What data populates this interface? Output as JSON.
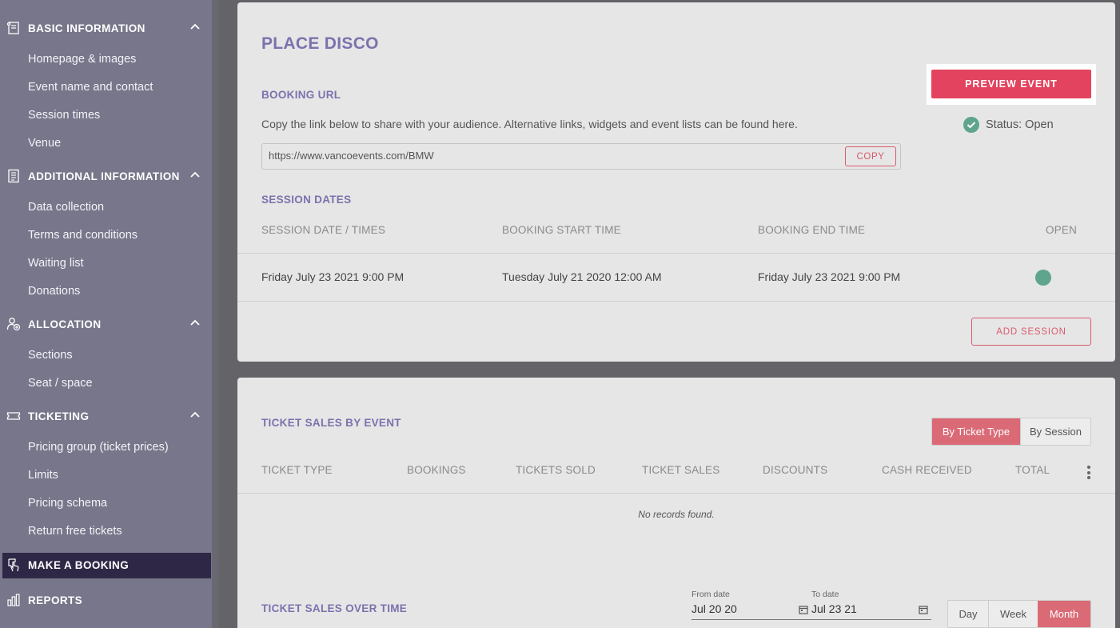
{
  "sidebar": {
    "groups": [
      {
        "label": "BASIC INFORMATION",
        "icon": "form-icon",
        "items": [
          "Homepage & images",
          "Event name and contact",
          "Session times",
          "Venue"
        ]
      },
      {
        "label": "ADDITIONAL INFORMATION",
        "icon": "document-icon",
        "items": [
          "Data collection",
          "Terms and conditions",
          "Waiting list",
          "Donations"
        ]
      },
      {
        "label": "ALLOCATION",
        "icon": "user-add-icon",
        "items": [
          "Sections",
          "Seat / space"
        ]
      },
      {
        "label": "TICKETING",
        "icon": "ticket-icon",
        "items": [
          "Pricing group (ticket prices)",
          "Limits",
          "Pricing schema",
          "Return free tickets"
        ]
      }
    ],
    "make_booking": {
      "label": "MAKE A BOOKING",
      "icon": "hand-pointer-icon"
    },
    "reports": {
      "label": "REPORTS",
      "icon": "bar-chart-icon"
    }
  },
  "event": {
    "title": "PLACE DISCO",
    "booking_url_label": "BOOKING URL",
    "description": "Copy the link below to share with your audience. Alternative links, widgets and event lists can be found here.",
    "url": "https://www.vancoevents.com/BMW",
    "copy_label": "COPY",
    "preview_label": "PREVIEW EVENT",
    "status": "Status: Open"
  },
  "sessions": {
    "label": "SESSION DATES",
    "columns": [
      "SESSION DATE / TIMES",
      "BOOKING START TIME",
      "BOOKING END TIME",
      "OPEN"
    ],
    "rows": [
      {
        "date": "Friday July 23 2021 9:00 PM",
        "start": "Tuesday July 21 2020 12:00 AM",
        "end": "Friday July 23 2021 9:00 PM",
        "open": true
      }
    ],
    "add_label": "ADD SESSION"
  },
  "ticket_sales": {
    "label": "TICKET SALES BY EVENT",
    "toggle": [
      "By Ticket Type",
      "By Session"
    ],
    "toggle_active": "By Ticket Type",
    "columns": [
      "TICKET TYPE",
      "BOOKINGS",
      "TICKETS SOLD",
      "TICKET SALES",
      "DISCOUNTS",
      "CASH RECEIVED",
      "TOTAL"
    ],
    "empty": "No records found."
  },
  "sales_over_time": {
    "label": "TICKET SALES OVER TIME",
    "from_label": "From date",
    "from_value": "Jul 20 20",
    "to_label": "To date",
    "to_value": "Jul 23 21",
    "periods": [
      "Day",
      "Week",
      "Month"
    ],
    "period_active": "Month"
  },
  "colors": {
    "accent": "#e3435e",
    "title": "#7b72ad",
    "success": "#5fa48c",
    "sidebar": "#77768a",
    "active_nav": "#2e2745"
  }
}
